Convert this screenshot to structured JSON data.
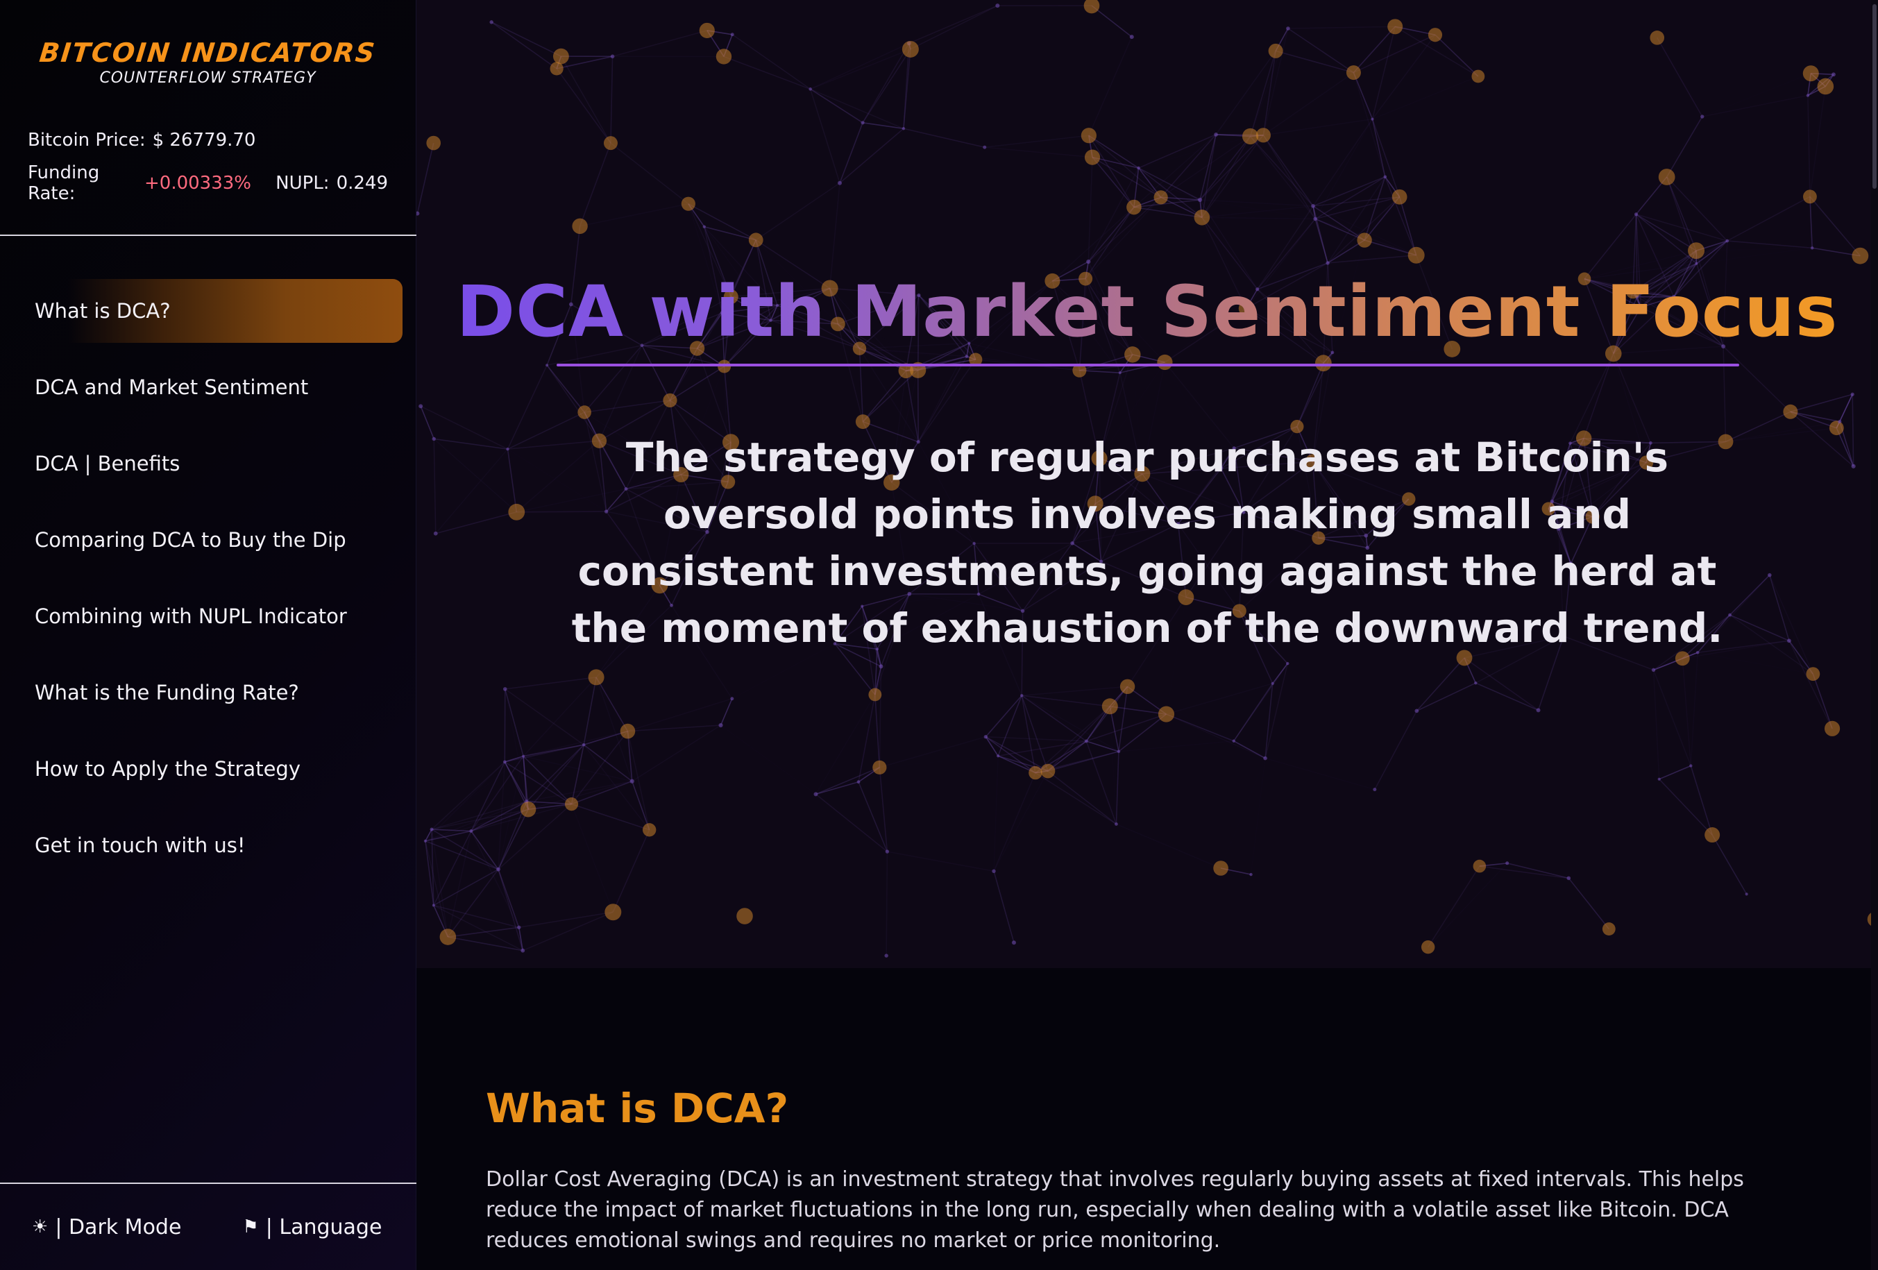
{
  "brand": {
    "title": "BITCOIN INDICATORS",
    "subtitle": "COUNTERFLOW STRATEGY"
  },
  "stats": {
    "price_label": "Bitcoin Price:",
    "price_value": "$ 26779.70",
    "funding_label": "Funding Rate:",
    "funding_value": "+0.00333%",
    "nupl_label": "NUPL:",
    "nupl_value": "0.249"
  },
  "nav": {
    "items": [
      {
        "label": "What is DCA?",
        "active": true
      },
      {
        "label": "DCA and Market Sentiment"
      },
      {
        "label": "DCA | Benefits"
      },
      {
        "label": "Comparing DCA to Buy the Dip"
      },
      {
        "label": "Combining with NUPL Indicator"
      },
      {
        "label": "What is the Funding Rate?"
      },
      {
        "label": "How to Apply the Strategy"
      },
      {
        "label": "Get in touch with us!"
      }
    ]
  },
  "footer": {
    "dark_mode_icon": "☀",
    "dark_mode_label": "| Dark Mode",
    "language_icon": "⚑",
    "language_label": "| Language"
  },
  "hero": {
    "title": "DCA with Market Sentiment Focus",
    "text": "The strategy of regular purchases at Bitcoin's oversold points involves making small and consistent investments, going against the herd at the moment of exhaustion of the downward trend."
  },
  "section": {
    "title": "What is DCA?",
    "text": "Dollar Cost Averaging (DCA) is an investment strategy that involves regularly buying assets at fixed intervals. This helps reduce the impact of market fluctuations in the long run, especially when dealing with a volatile asset like Bitcoin. DCA reduces emotional swings and requires no market or price monitoring."
  },
  "colors": {
    "accent_orange": "#f7931a",
    "funding_red": "#ff6b7f",
    "network_purple": "#6a4aa8",
    "network_node": "#c7802a"
  }
}
